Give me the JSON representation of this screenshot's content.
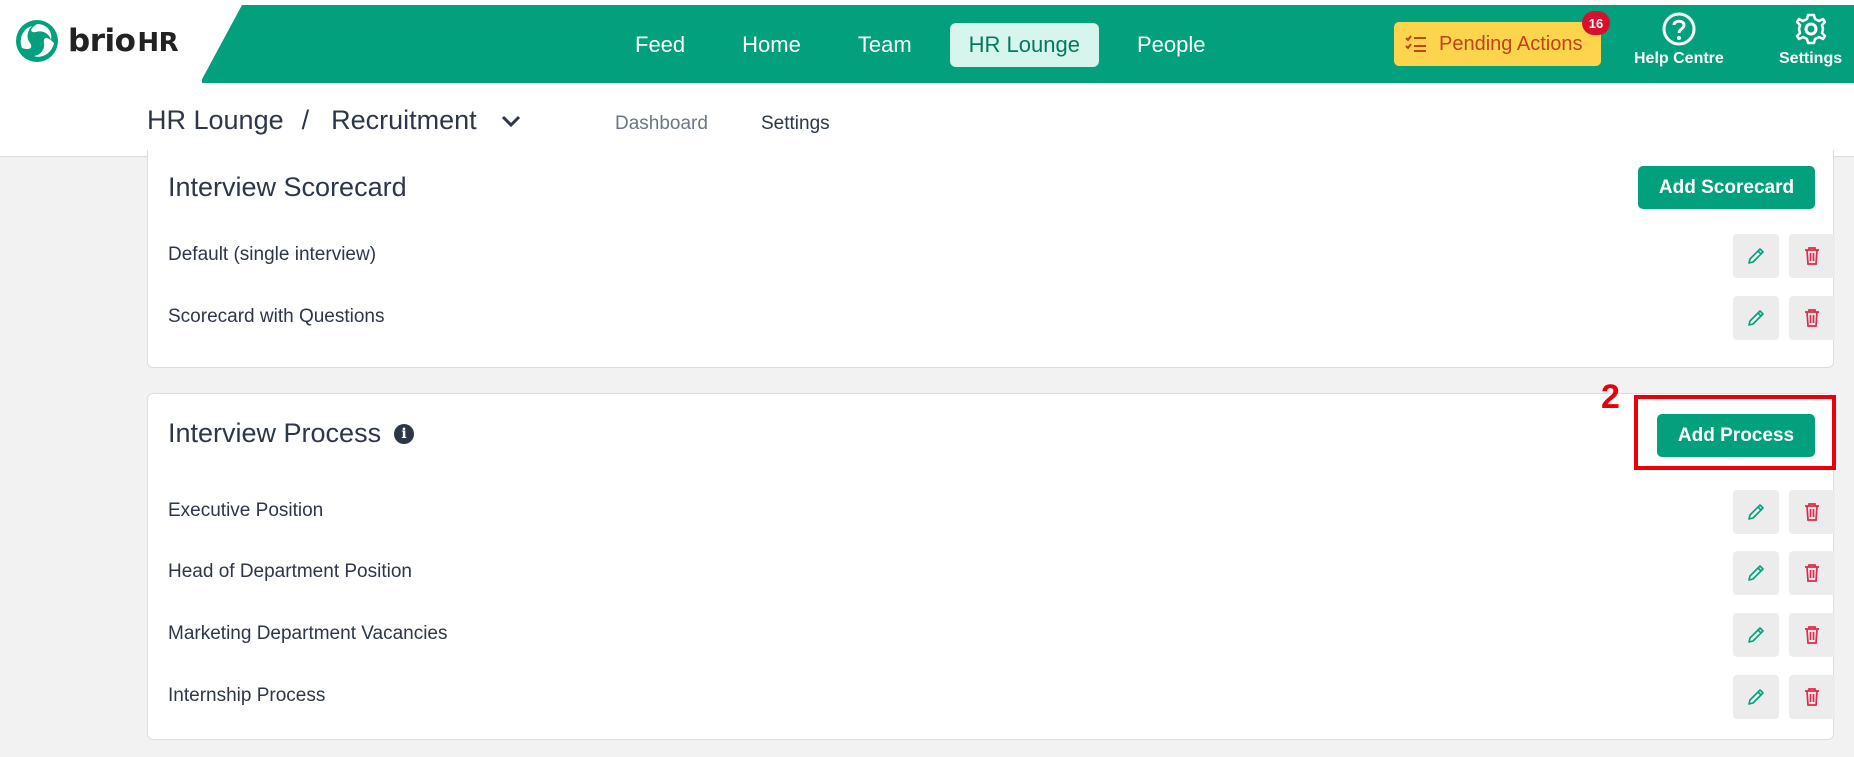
{
  "brand": {
    "name": "brio",
    "suffix": "HR"
  },
  "nav": {
    "items": [
      "Feed",
      "Home",
      "Team",
      "HR Lounge",
      "People"
    ],
    "active": "HR Lounge"
  },
  "pending_actions": {
    "label": "Pending Actions",
    "count": "16"
  },
  "tools": {
    "help_label": "Help Centre",
    "settings_label": "Settings"
  },
  "breadcrumb": {
    "section": "HR Lounge",
    "separator": "/",
    "page": "Recruitment"
  },
  "tabs": {
    "dashboard": "Dashboard",
    "settings": "Settings",
    "active": "Settings"
  },
  "scorecard": {
    "title": "Interview Scorecard",
    "add_label": "Add Scorecard",
    "items": [
      "Default (single interview)",
      "Scorecard with Questions"
    ]
  },
  "process": {
    "title": "Interview Process",
    "info_icon": "info-icon",
    "add_label": "Add Process",
    "items": [
      "Executive Position",
      "Head of Department Position",
      "Marketing Department Vacancies",
      "Internship Process"
    ]
  },
  "annotation": {
    "label": "2",
    "color": "#e8000b"
  },
  "colors": {
    "brand": "#03a07d",
    "pending_bg": "#fdd54d",
    "badge": "#d7112d",
    "delete": "#e0294a"
  }
}
